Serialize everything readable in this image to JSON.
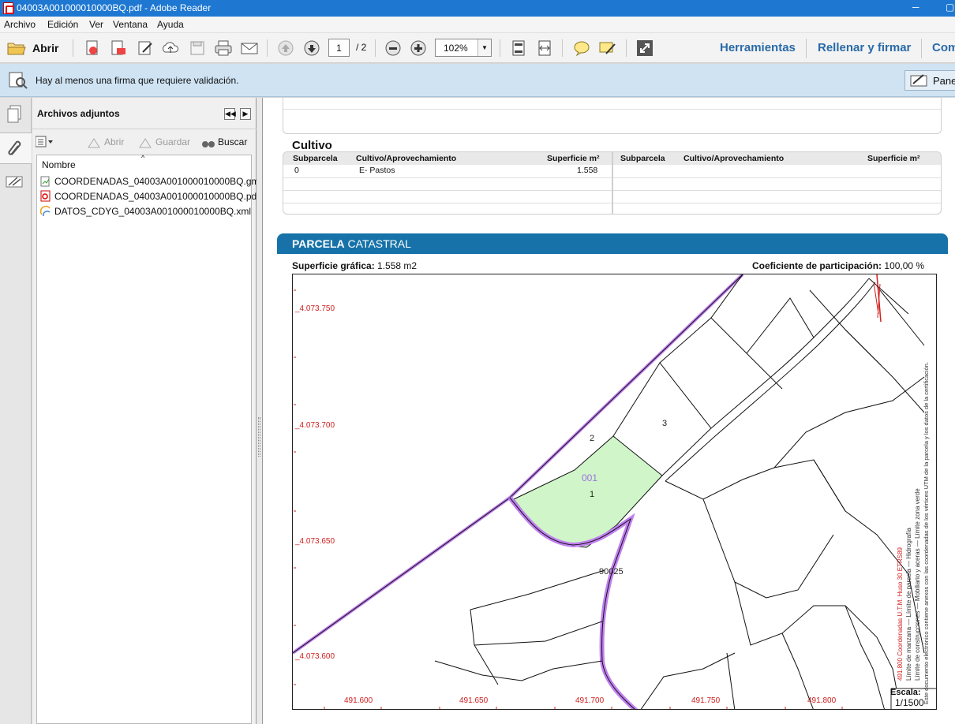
{
  "window": {
    "title": "04003A001000010000BQ.pdf - Adobe Reader"
  },
  "menu": {
    "items": [
      "Archivo",
      "Edición",
      "Ver",
      "Ventana",
      "Ayuda"
    ]
  },
  "toolbar": {
    "open_label": "Abrir",
    "page_current": "1",
    "page_total": "/ 2",
    "zoom": "102%",
    "tools_label": "Herramientas",
    "fill_sign_label": "Rellenar y firmar",
    "comment_label": "Com"
  },
  "notice": {
    "text": "Hay al menos una firma que requiere validación.",
    "panel_label": "Pane"
  },
  "attachments": {
    "title": "Archivos adjuntos",
    "open_label": "Abrir",
    "save_label": "Guardar",
    "search_label": "Buscar",
    "column_name": "Nombre",
    "files": [
      {
        "name": "COORDENADAS_04003A001000010000BQ.gml",
        "icon": "gml-file-icon"
      },
      {
        "name": "COORDENADAS_04003A001000010000BQ.pdf",
        "icon": "pdf-file-icon"
      },
      {
        "name": "DATOS_CDYG_04003A001000010000BQ.xml",
        "icon": "xml-file-icon"
      }
    ]
  },
  "document": {
    "cultivo_title": "Cultivo",
    "table_headers": [
      "Subparcela",
      "Cultivo/Aprovechamiento",
      "Superficie m²",
      "Subparcela",
      "Cultivo/Aprovechamiento",
      "Superficie m²"
    ],
    "rows": [
      {
        "subparcela": "0",
        "cultivo": "E- Pastos",
        "superficie": "1.558"
      }
    ],
    "parcela_title_bold": "PARCELA",
    "parcela_title_rest": "CATASTRAL",
    "superficie_label": "Superficie gráfica:",
    "superficie_value": "1.558 m2",
    "coef_label": "Coeficiente de participación:",
    "coef_value": "100,00 %",
    "map": {
      "y_labels": [
        "_4.073.750",
        "_4.073.700",
        "_4.073.650",
        "_4.073.600"
      ],
      "x_labels": [
        "491.600",
        "491.650",
        "491.700",
        "491.750",
        "491.800"
      ],
      "parcel_code": "001",
      "parcel_numbers": [
        "1",
        "2",
        "3",
        "90025"
      ],
      "legend_line1": "Límite de manzana  —  Límite de parcela  —  Hidrografía",
      "legend_line2": "Límite de construcciones  —  Mobiliario y aceras  —  Límite zona verde",
      "legend_line3": "Este documento electrónico contiene anexos con las coordenadas de los vértices UTM de la parcela y los datos de la certificación.",
      "legend_red": "491.800 Coordenadas U.T.M. Huso 30 ETRS89",
      "escala_label": "Escala:",
      "escala_value": "1/1500"
    }
  },
  "colors": {
    "titlebar": "#1e78d2",
    "accent": "#1672a8",
    "parcel_fill": "#cff5c8",
    "parcel_border": "#c080f0",
    "coord_red": "#d02020"
  }
}
